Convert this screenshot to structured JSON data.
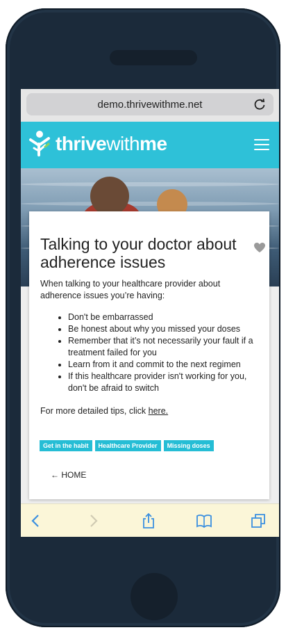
{
  "browser": {
    "url": "demo.thrivewithme.net"
  },
  "header": {
    "logo_bold": "thrive",
    "logo_light": "with",
    "logo_bold2": "me"
  },
  "article": {
    "title": "Talking to your doctor about adherence issues",
    "intro": "When talking to your healthcare provider about adherence issues you’re having:",
    "bullets": [
      "Don't be embarrassed",
      "Be honest about why you missed your doses",
      "Remember that it’s not necessarily your fault if a treatment failed for you",
      "Learn from it and commit to the next regimen",
      "If this healthcare provider isn't working for you, don't be afraid to switch"
    ],
    "more_prefix": "For more detailed tips, click",
    "more_link": "here.",
    "tags": [
      "Get in the habit",
      "Healthcare Provider",
      "Missing doses"
    ],
    "home_link": "← HOME"
  },
  "colors": {
    "accent": "#2ec1d8",
    "toolbar_bg": "#fbf6d8",
    "toolbar_icon": "#3a8fe0"
  },
  "toolbar_icons": [
    "back-icon",
    "forward-icon",
    "share-icon",
    "bookmarks-icon",
    "tabs-icon"
  ]
}
